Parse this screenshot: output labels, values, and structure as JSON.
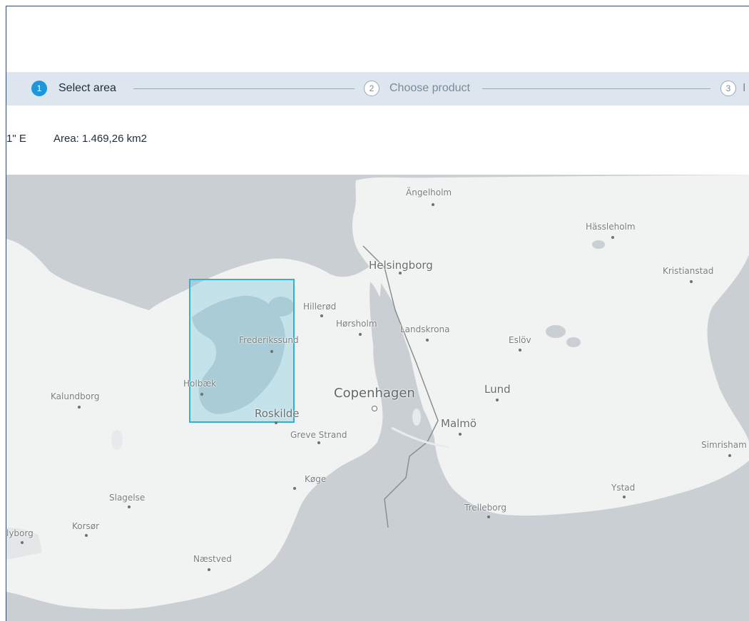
{
  "stepper": {
    "steps": [
      {
        "number": "1",
        "label": "Select area"
      },
      {
        "number": "2",
        "label": "Choose product"
      },
      {
        "number": "3",
        "label": "I"
      }
    ]
  },
  "info": {
    "coordinate_fragment": "1\" E",
    "area": "Area: 1.469,26 km2"
  },
  "map": {
    "cities": [
      {
        "name": "Ängelholm"
      },
      {
        "name": "Hässleholm"
      },
      {
        "name": "Helsingborg"
      },
      {
        "name": "Kristianstad"
      },
      {
        "name": "Hillerød"
      },
      {
        "name": "Hørsholm"
      },
      {
        "name": "Landskrona"
      },
      {
        "name": "Frederikssund"
      },
      {
        "name": "Eslöv"
      },
      {
        "name": "Kalundborg"
      },
      {
        "name": "Holbæk"
      },
      {
        "name": "Copenhagen"
      },
      {
        "name": "Lund"
      },
      {
        "name": "Roskilde"
      },
      {
        "name": "Malmö"
      },
      {
        "name": "Greve Strand"
      },
      {
        "name": "Simrisham"
      },
      {
        "name": "Køge"
      },
      {
        "name": "Ystad"
      },
      {
        "name": "Slagelse"
      },
      {
        "name": "Trelleborg"
      },
      {
        "name": "Korsør"
      },
      {
        "name": "lyborg"
      },
      {
        "name": "Næstved"
      }
    ]
  }
}
